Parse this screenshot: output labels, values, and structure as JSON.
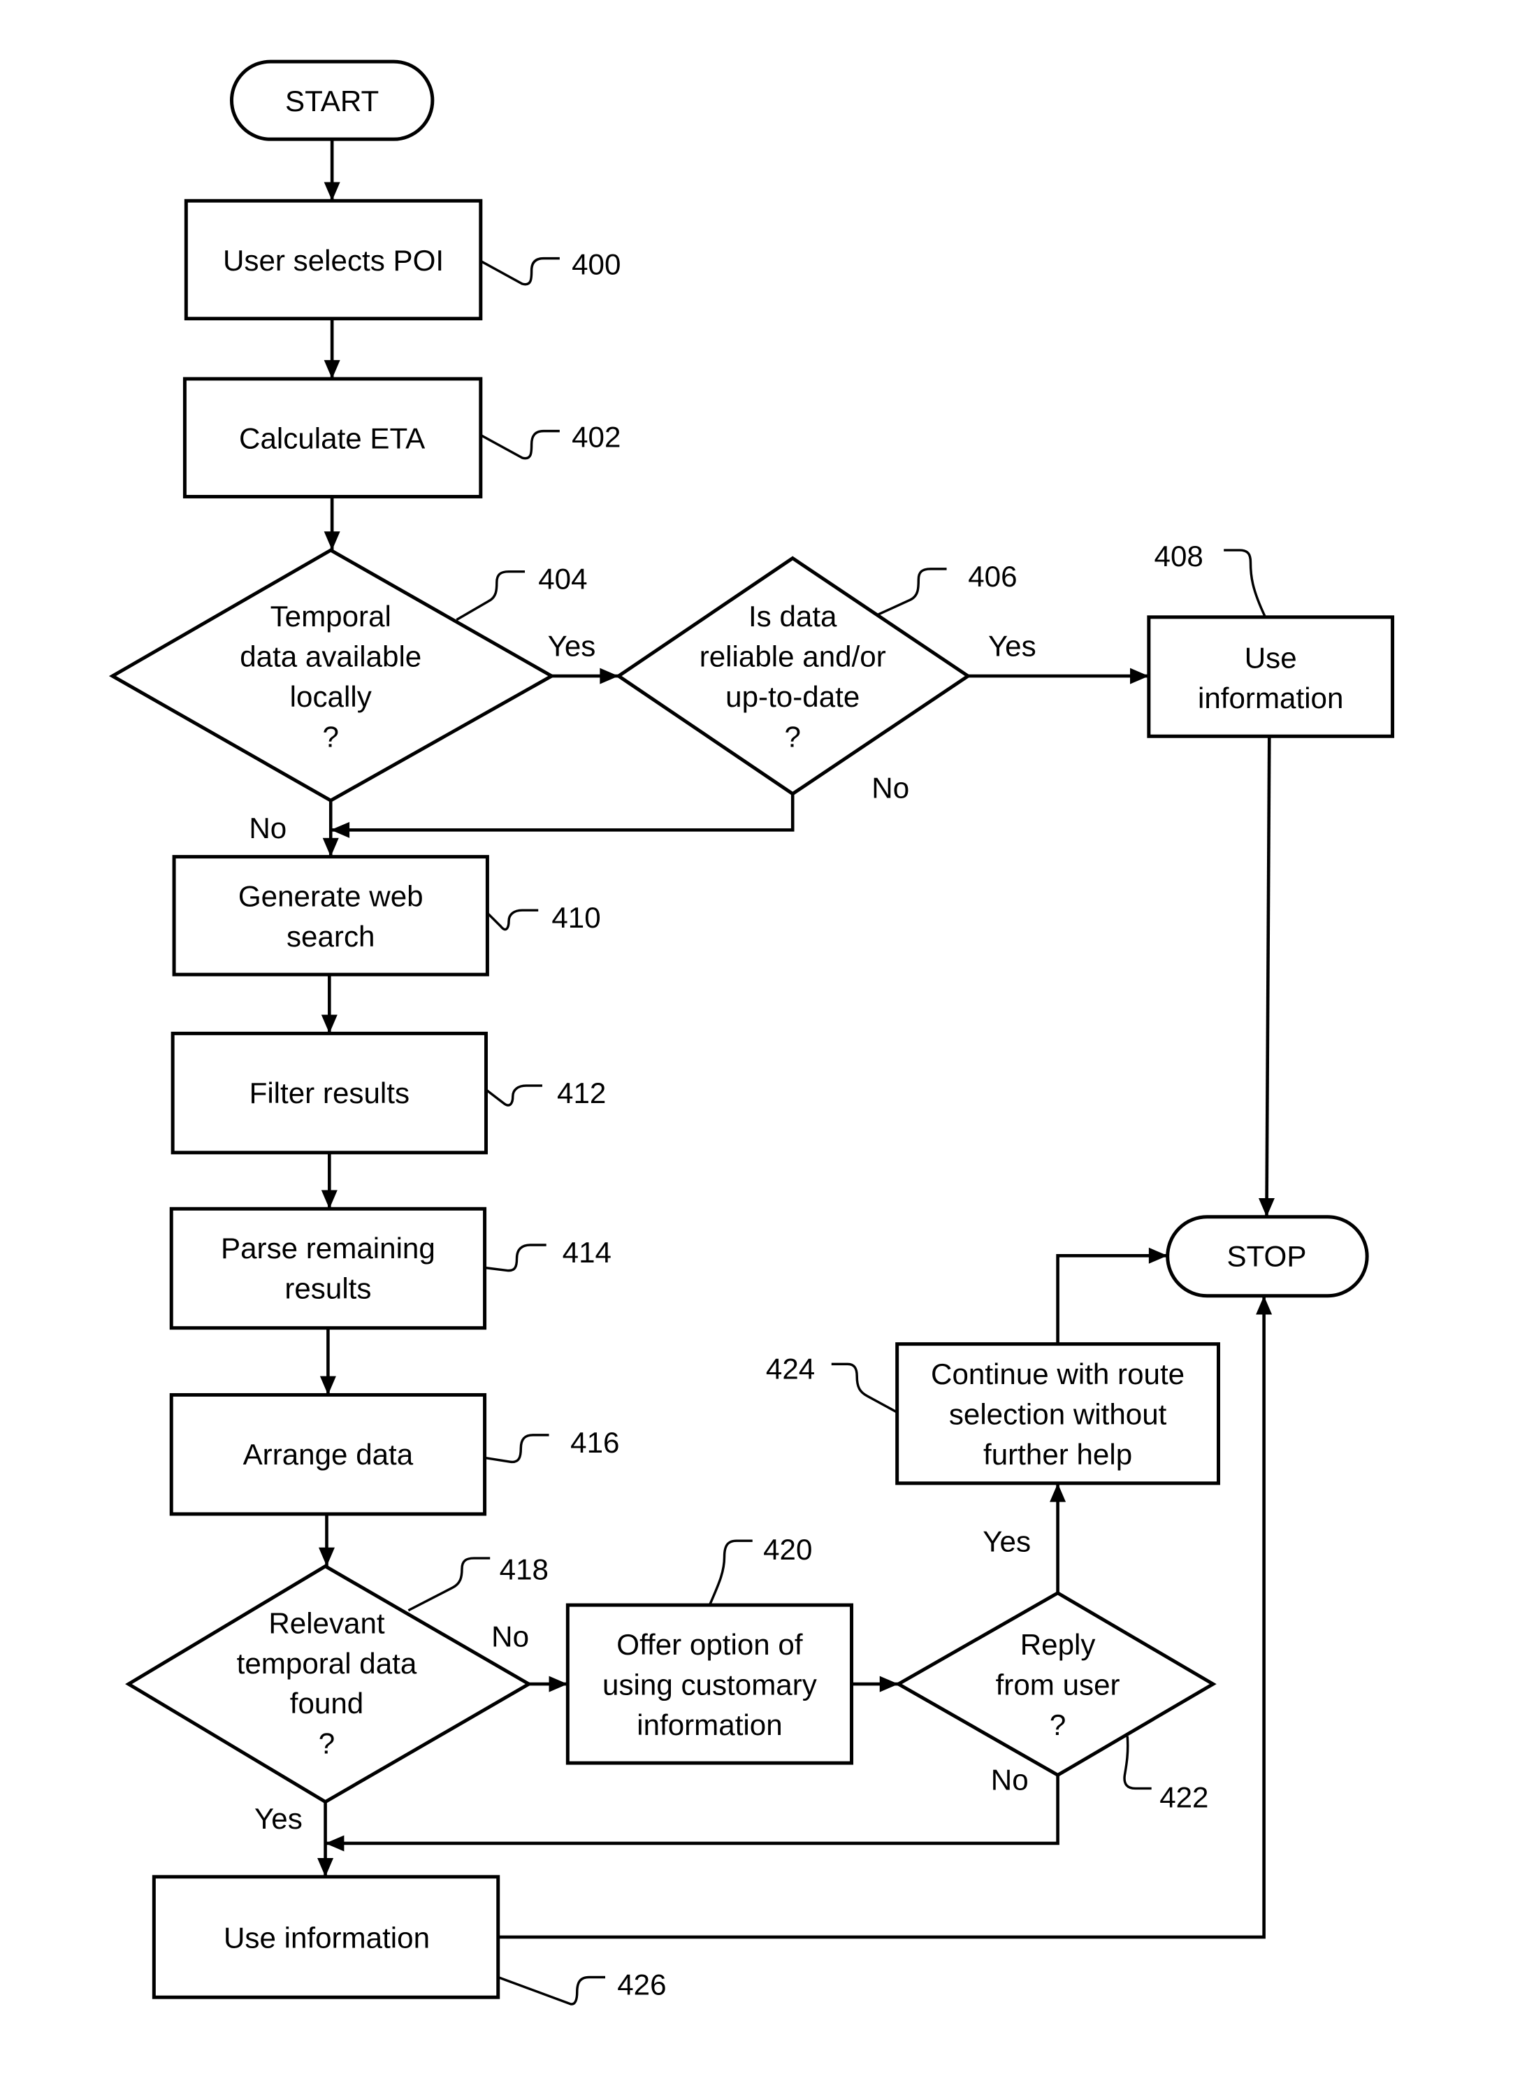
{
  "figure": {
    "type": "flowchart",
    "nodes": {
      "start": {
        "kind": "terminal",
        "lines": [
          "START"
        ]
      },
      "n400": {
        "kind": "process",
        "ref": "400",
        "lines": [
          "User selects POI"
        ]
      },
      "n402": {
        "kind": "process",
        "ref": "402",
        "lines": [
          "Calculate ETA"
        ]
      },
      "n404": {
        "kind": "decision",
        "ref": "404",
        "lines": [
          "Temporal",
          "data available",
          "locally",
          "?"
        ]
      },
      "n406": {
        "kind": "decision",
        "ref": "406",
        "lines": [
          "Is data",
          "reliable and/or",
          "up-to-date",
          "?"
        ]
      },
      "n408": {
        "kind": "process",
        "ref": "408",
        "lines": [
          "Use",
          "information"
        ]
      },
      "n410": {
        "kind": "process",
        "ref": "410",
        "lines": [
          "Generate web",
          "search"
        ]
      },
      "n412": {
        "kind": "process",
        "ref": "412",
        "lines": [
          "Filter results"
        ]
      },
      "n414": {
        "kind": "process",
        "ref": "414",
        "lines": [
          "Parse remaining",
          "results"
        ]
      },
      "n416": {
        "kind": "process",
        "ref": "416",
        "lines": [
          "Arrange data"
        ]
      },
      "n418": {
        "kind": "decision",
        "ref": "418",
        "lines": [
          "Relevant",
          "temporal data",
          "found",
          "?"
        ]
      },
      "n420": {
        "kind": "process",
        "ref": "420",
        "lines": [
          "Offer option of",
          "using customary",
          "information"
        ]
      },
      "n422": {
        "kind": "decision",
        "ref": "422",
        "lines": [
          "Reply",
          "from user",
          "?"
        ]
      },
      "n424": {
        "kind": "process",
        "ref": "424",
        "lines": [
          "Continue with route",
          "selection without",
          "further help"
        ]
      },
      "n426": {
        "kind": "process",
        "ref": "426",
        "lines": [
          "Use information"
        ]
      },
      "stop": {
        "kind": "terminal",
        "lines": [
          "STOP"
        ]
      }
    },
    "edges": [
      {
        "from": "start",
        "to": "n400",
        "label": ""
      },
      {
        "from": "n400",
        "to": "n402",
        "label": ""
      },
      {
        "from": "n402",
        "to": "n404",
        "label": ""
      },
      {
        "from": "n404",
        "to": "n406",
        "label": "Yes"
      },
      {
        "from": "n404",
        "to": "n410",
        "label": "No"
      },
      {
        "from": "n406",
        "to": "n408",
        "label": "Yes"
      },
      {
        "from": "n406",
        "to": "n410",
        "label": "No"
      },
      {
        "from": "n408",
        "to": "stop",
        "label": ""
      },
      {
        "from": "n410",
        "to": "n412",
        "label": ""
      },
      {
        "from": "n412",
        "to": "n414",
        "label": ""
      },
      {
        "from": "n414",
        "to": "n416",
        "label": ""
      },
      {
        "from": "n416",
        "to": "n418",
        "label": ""
      },
      {
        "from": "n418",
        "to": "n420",
        "label": "No"
      },
      {
        "from": "n418",
        "to": "n426",
        "label": "Yes"
      },
      {
        "from": "n420",
        "to": "n422",
        "label": ""
      },
      {
        "from": "n422",
        "to": "n424",
        "label": "Yes"
      },
      {
        "from": "n422",
        "to": "n426",
        "label": "No"
      },
      {
        "from": "n424",
        "to": "stop",
        "label": ""
      },
      {
        "from": "n426",
        "to": "stop",
        "label": ""
      }
    ],
    "edge_labels": {
      "yes": "Yes",
      "no": "No"
    }
  }
}
